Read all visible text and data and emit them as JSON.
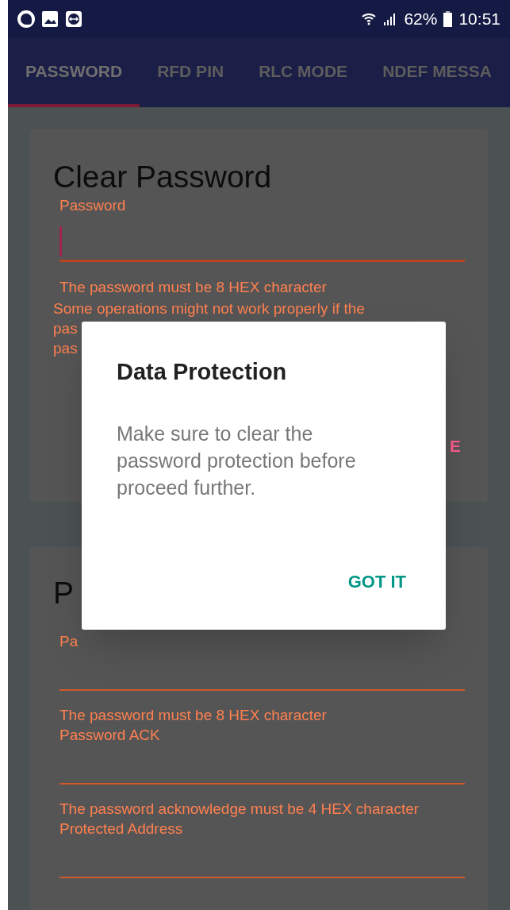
{
  "status_bar": {
    "battery": "62%",
    "time": "10:51"
  },
  "tabs": [
    {
      "label": "PASSWORD",
      "selected": true
    },
    {
      "label": "RFD PIN",
      "selected": false
    },
    {
      "label": "RLC MODE",
      "selected": false
    },
    {
      "label": "NDEF MESSA",
      "selected": false
    }
  ],
  "clear_card": {
    "title": "Clear Password",
    "field_label": "Password",
    "helper": "The password must be 8 HEX character",
    "warning_lines": [
      "Some operations might not work properly if the",
      "pas",
      "pas"
    ],
    "button": "E"
  },
  "set_card": {
    "title": "P",
    "fields": [
      {
        "label": "Pa",
        "helper": "The password must be 8 HEX character"
      },
      {
        "label": "Password ACK",
        "helper": "The password acknowledge must be 4 HEX character"
      },
      {
        "label": "Protected Address"
      }
    ]
  },
  "dialog": {
    "title": "Data Protection",
    "message": "Make sure to clear the password protection before proceed further.",
    "button": "GOT IT"
  }
}
